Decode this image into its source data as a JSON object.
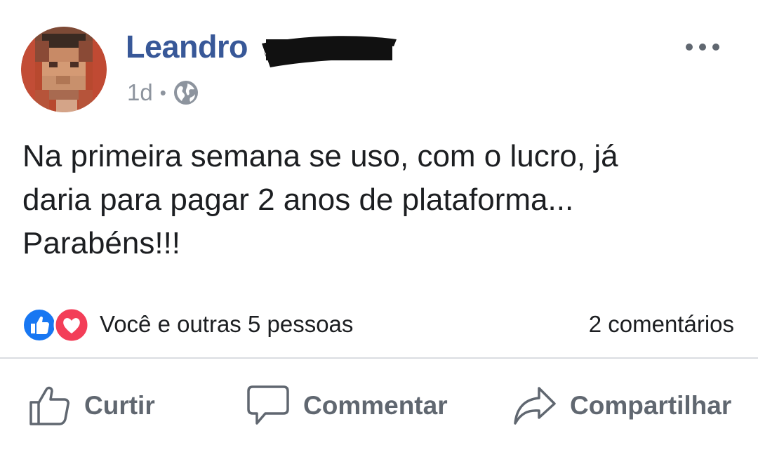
{
  "post": {
    "author_name": "Leandro",
    "time": "1d",
    "separator": "•",
    "audience_icon": "globe-icon",
    "text": "Na primeira semana se uso, com o lucro, já\ndaria para pagar 2 anos de plataforma...\nParabéns!!!",
    "reactions_text": "Você e outras 5 pessoas",
    "comments_text": "2 comentários"
  },
  "actions": {
    "like_label": "Curtir",
    "comment_label": "Commentar",
    "share_label": "Compartilhar"
  },
  "colors": {
    "author": "#385898",
    "meta": "#8d949e",
    "text": "#1c1e21",
    "action": "#606770",
    "like_blue": "#1877f2",
    "love_red": "#f33e58",
    "divider": "#dadde1"
  }
}
